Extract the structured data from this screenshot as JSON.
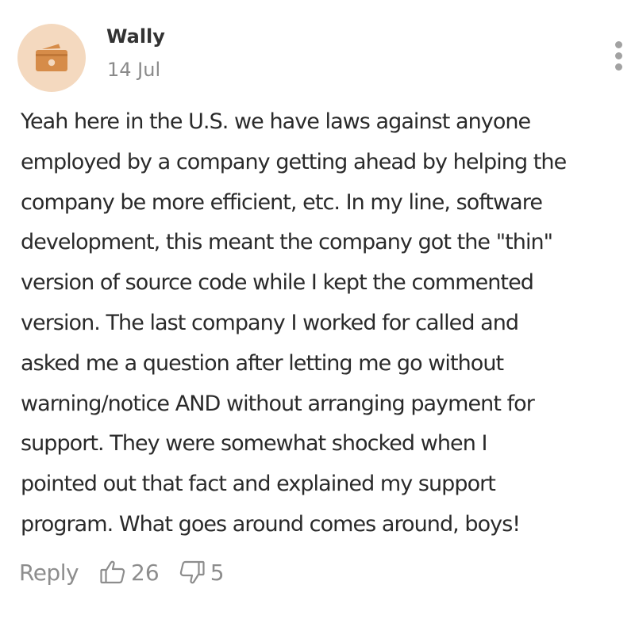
{
  "comment": {
    "author": "Wally",
    "date": "14 Jul",
    "avatar_icon": "wallet-icon",
    "avatar_bg": "#f4d9bf",
    "avatar_fg": "#d68c49",
    "menu_icon": "vertical-dots-icon",
    "body_lines": [
      "Yeah here in the U.S. we have laws against anyone",
      "employed by a company getting ahead by helping the",
      "company be more efficient, etc. In my line, software",
      "development, this meant the company got the \"thin\"",
      "version of source code while I kept the commented",
      "version. The last company I worked for called and",
      "asked me a question after letting me go without",
      "warning/notice AND without arranging payment for",
      "support. They were somewhat shocked when I",
      "pointed out that fact and explained my support",
      "program. What goes around comes around, boys!"
    ]
  },
  "actions": {
    "reply_label": "Reply",
    "upvote_icon": "thumbs-up-icon",
    "upvote_count": "26",
    "downvote_icon": "thumbs-down-icon",
    "downvote_count": "5"
  }
}
